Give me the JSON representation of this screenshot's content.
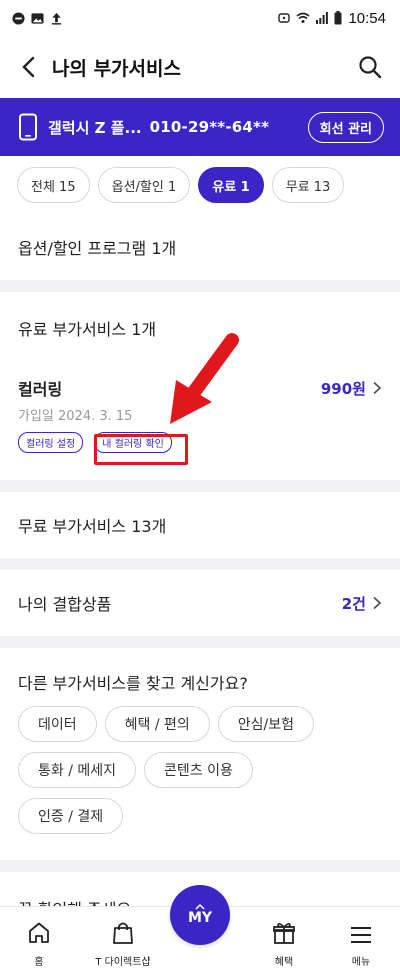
{
  "statusbar": {
    "time": "10:54"
  },
  "header": {
    "title": "나의 부가서비스"
  },
  "device": {
    "name": "갤럭시 Z 플...",
    "number": "010-29**-64**",
    "manage_label": "회선 관리"
  },
  "filters": [
    {
      "label": "전체 15"
    },
    {
      "label": "옵션/할인 1"
    },
    {
      "label": "유료 1"
    },
    {
      "label": "무료 13"
    }
  ],
  "sections": {
    "options_title": "옵션/할인 프로그램 1개",
    "paid_title": "유료 부가서비스 1개",
    "paid_item": {
      "name": "컬러링",
      "price": "990원",
      "joined": "가입일 2024. 3. 15",
      "tag1": "컬러링 설정",
      "tag2": "내 컬러링 확인"
    },
    "free_title": "무료 부가서비스 13개",
    "bundle_title": "나의 결합상품",
    "bundle_count": "2건",
    "find_title": "다른 부가서비스를 찾고 계신가요?",
    "categories": [
      "데이터",
      "혜택 / 편의",
      "안심/보험",
      "통화 / 메세지",
      "콘텐츠 이용",
      "인증 / 결제"
    ],
    "notice_title": "꼭 확인해 주세요"
  },
  "bottomnav": {
    "home": "홈",
    "shop": "T 다이렉트샵",
    "my": "MY",
    "benefit": "혜택",
    "menu": "메뉴"
  },
  "colors": {
    "brand": "#3b25c5",
    "annotation": "#e0181e"
  }
}
